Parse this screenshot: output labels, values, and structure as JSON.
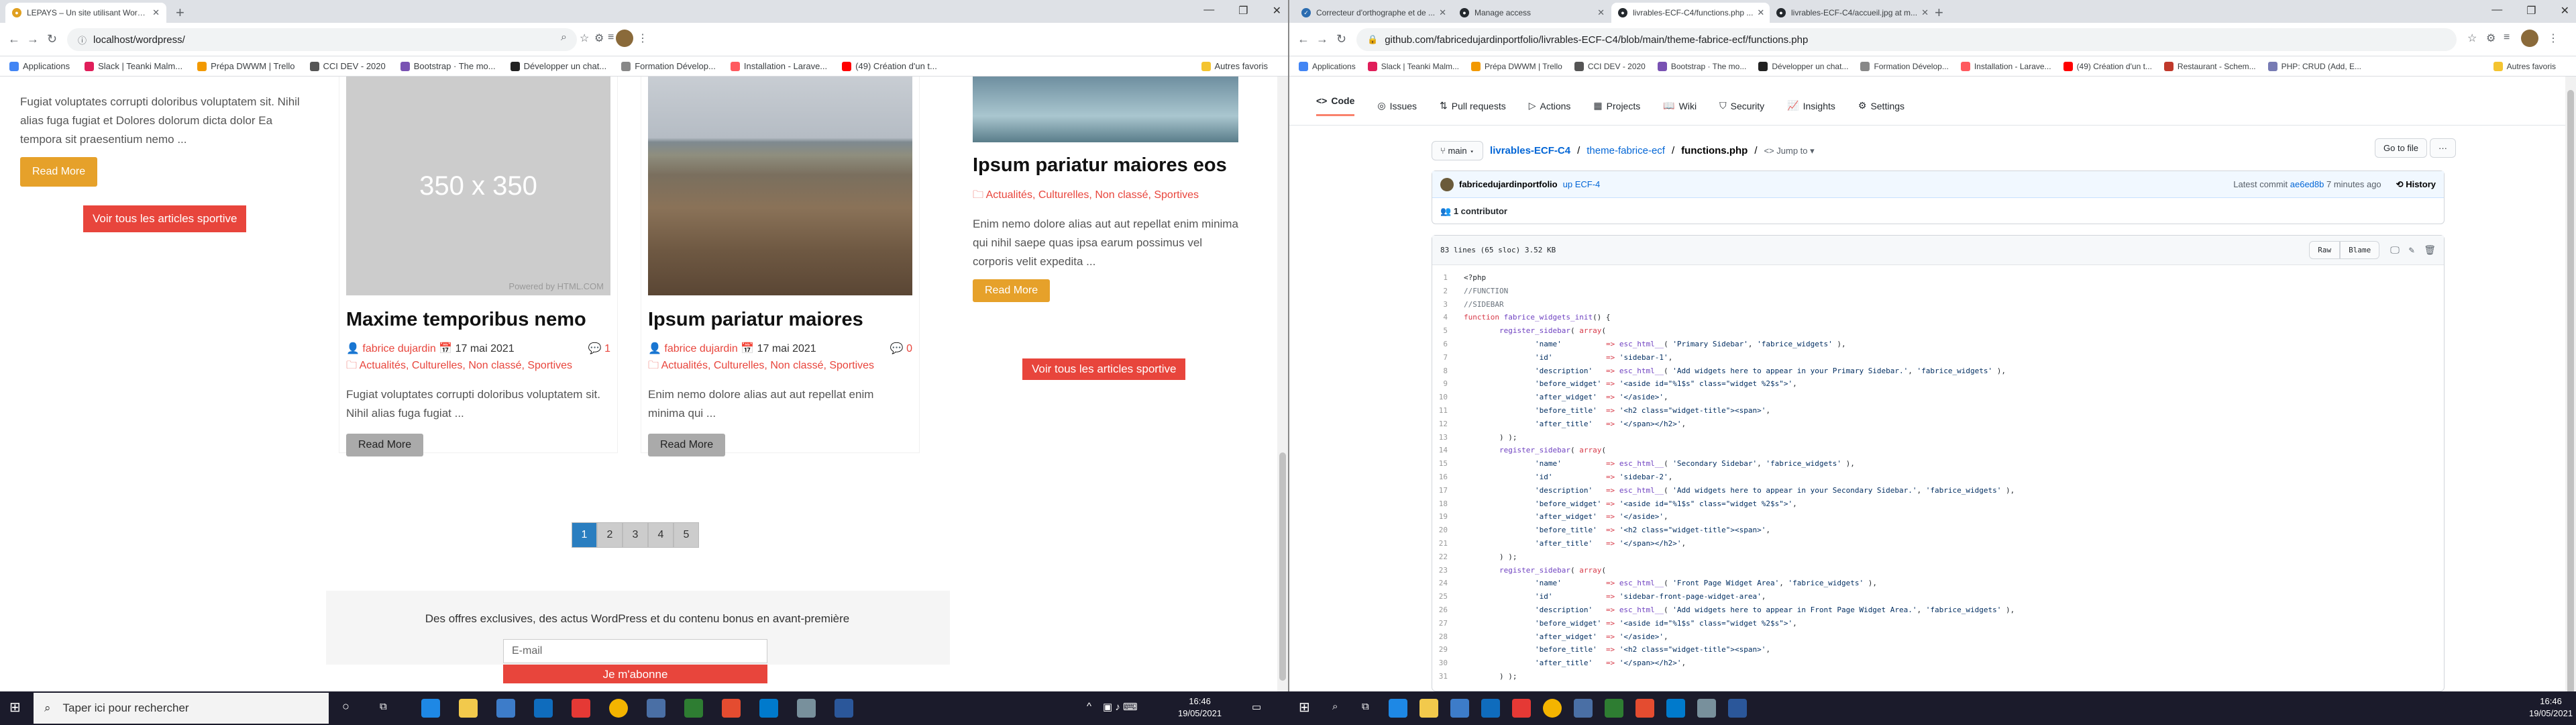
{
  "left": {
    "tabs": [
      {
        "title": "LEPAYS – Un site utilisant WordPress",
        "active": true
      }
    ],
    "url": "localhost/wordpress/",
    "bookmarks": [
      "Applications",
      "Slack | Teanki Malm...",
      "Prépa DWWM | Trello",
      "CCI DEV - 2020",
      "Bootstrap · The mo...",
      "Développer un chat...",
      "Formation Dévelop...",
      "Installation - Larave...",
      "(49) Création d'un t..."
    ],
    "bookmarks_more": "Autres favoris",
    "col1": {
      "excerpt": "Fugiat voluptates corrupti doloribus voluptatem sit. Nihil alias fuga fugiat et Dolores dolorum dicta dolor Ea tempora sit praesentium nemo ...",
      "read_more": "Read More",
      "see_all": "Voir tous les articles sportive"
    },
    "cards": [
      {
        "placeholder": "350 x 350",
        "powered": "Powered by HTML.COM",
        "title": "Maxime temporibus nemo",
        "author": "fabrice dujardin",
        "date": "17 mai 2021",
        "comments": "1",
        "cats": "Actualités, Culturelles, Non classé, Sportives",
        "excerpt": "Fugiat voluptates corrupti doloribus voluptatem sit. Nihil alias fuga fugiat ...",
        "read_more": "Read More"
      },
      {
        "title": "Ipsum pariatur maiores",
        "author": "fabrice dujardin",
        "date": "17 mai 2021",
        "comments": "0",
        "cats": "Actualités, Culturelles, Non classé, Sportives",
        "excerpt": "Enim nemo dolore alias aut aut repellat enim minima qui ...",
        "read_more": "Read More"
      }
    ],
    "col4": {
      "title": "Ipsum pariatur maiores eos",
      "cats": "Actualités, Culturelles, Non classé, Sportives",
      "excerpt": "Enim nemo dolore alias aut aut repellat enim minima qui nihil saepe quas ipsa earum possimus vel corporis velit expedita ...",
      "read_more": "Read More",
      "see_all": "Voir tous les articles sportive"
    },
    "pages": [
      "1",
      "2",
      "3",
      "4",
      "5"
    ],
    "footer_text": "Des offres exclusives, des actus WordPress et du contenu bonus en avant-première",
    "email_placeholder": "E-mail",
    "subscribe": "Je m'abonne"
  },
  "right": {
    "tabs": [
      {
        "title": "Correcteur d'orthographe et de ...",
        "active": false
      },
      {
        "title": "Manage access",
        "active": false
      },
      {
        "title": "livrables-ECF-C4/functions.php ...",
        "active": true
      },
      {
        "title": "livrables-ECF-C4/accueil.jpg at m...",
        "active": false
      }
    ],
    "url": "github.com/fabricedujardinportfolio/livrables-ECF-C4/blob/main/theme-fabrice-ecf/functions.php",
    "bookmarks": [
      "Applications",
      "Slack | Teanki Malm...",
      "Prépa DWWM | Trello",
      "CCI DEV - 2020",
      "Bootstrap · The mo...",
      "Développer un chat...",
      "Formation Dévelop...",
      "Installation - Larave...",
      "(49) Création d'un t...",
      "Restaurant - Schem...",
      "PHP: CRUD (Add, E..."
    ],
    "bookmarks_more": "Autres favoris",
    "repo_tabs": [
      "Code",
      "Issues",
      "Pull requests",
      "Actions",
      "Projects",
      "Wiki",
      "Security",
      "Insights",
      "Settings"
    ],
    "branch": "main",
    "breadcrumb": {
      "repo": "livrables-ECF-C4",
      "folder": "theme-fabrice-ecf",
      "file": "functions.php",
      "jump": "Jump to"
    },
    "go_to_file": "Go to file",
    "commit": {
      "author": "fabricedujardinportfolio",
      "message": "up ECF-4",
      "latest": "Latest commit ",
      "hash": "ae6ed8b",
      "when": " 7 minutes ago",
      "history": "History"
    },
    "contributors": "1 contributor",
    "file_info": "83 lines (65 sloc)   3.52 KB",
    "file_actions": [
      "Raw",
      "Blame"
    ],
    "code": [
      "<?php",
      "//FUNCTION",
      "//SIDEBAR",
      "function fabrice_widgets_init() {",
      "        register_sidebar( array(",
      "                'name'          => esc_html__( 'Primary Sidebar', 'fabrice_widgets' ),",
      "                'id'            => 'sidebar-1',",
      "                'description'   => esc_html__( 'Add widgets here to appear in your Primary Sidebar.', 'fabrice_widgets' ),",
      "                'before_widget' => '<aside id=\"%1$s\" class=\"widget %2$s\">',",
      "                'after_widget'  => '</aside>',",
      "                'before_title'  => '<h2 class=\"widget-title\"><span>',",
      "                'after_title'   => '</span></h2>',",
      "        ) );",
      "        register_sidebar( array(",
      "                'name'          => esc_html__( 'Secondary Sidebar', 'fabrice_widgets' ),",
      "                'id'            => 'sidebar-2',",
      "                'description'   => esc_html__( 'Add widgets here to appear in your Secondary Sidebar.', 'fabrice_widgets' ),",
      "                'before_widget' => '<aside id=\"%1$s\" class=\"widget %2$s\">',",
      "                'after_widget'  => '</aside>',",
      "                'before_title'  => '<h2 class=\"widget-title\"><span>',",
      "                'after_title'   => '</span></h2>',",
      "        ) );",
      "        register_sidebar( array(",
      "                'name'          => esc_html__( 'Front Page Widget Area', 'fabrice_widgets' ),",
      "                'id'            => 'sidebar-front-page-widget-area',",
      "                'description'   => esc_html__( 'Add widgets here to appear in Front Page Widget Area.', 'fabrice_widgets' ),",
      "                'before_widget' => '<aside id=\"%1$s\" class=\"widget %2$s\">',",
      "                'after_widget'  => '</aside>',",
      "                'before_title'  => '<h2 class=\"widget-title\"><span>',",
      "                'after_title'   => '</span></h2>',",
      "        ) );"
    ]
  },
  "taskbar": {
    "search_placeholder": "Taper ici pour rechercher",
    "time": "16:46",
    "date": "19/05/2021"
  }
}
